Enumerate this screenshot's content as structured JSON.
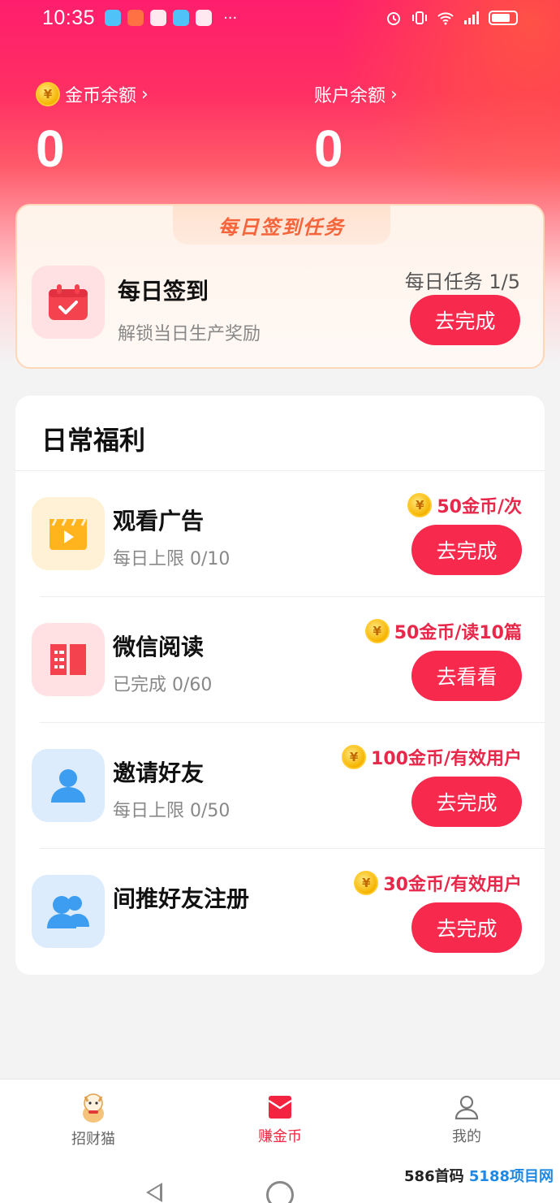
{
  "status_bar": {
    "time": "10:35",
    "more": "···"
  },
  "balances": {
    "coins": {
      "label": "金币余额",
      "value": "0",
      "chevron": "›"
    },
    "account": {
      "label": "账户余额",
      "value": "0",
      "chevron": "›"
    },
    "coin_glyph": "¥"
  },
  "sign_in": {
    "tab_title": "每日签到任务",
    "task_title": "每日签到",
    "task_subtitle": "解锁当日生产奖励",
    "progress": "每日任务 1/5",
    "button": "去完成"
  },
  "welfare": {
    "title": "日常福利",
    "items": [
      {
        "title": "观看广告",
        "subtitle": "每日上限 0/10",
        "reward": "50金币/次",
        "button": "去完成",
        "icon": "video-icon"
      },
      {
        "title": "微信阅读",
        "subtitle": "已完成 0/60",
        "reward": "50金币/读10篇",
        "button": "去看看",
        "icon": "book-icon"
      },
      {
        "title": "邀请好友",
        "subtitle": "每日上限 0/50",
        "reward": "100金币/有效用户",
        "button": "去完成",
        "icon": "user-icon"
      },
      {
        "title": "间推好友注册",
        "subtitle": "",
        "reward": "30金币/有效用户",
        "button": "去完成",
        "icon": "users-icon"
      }
    ]
  },
  "bottom_nav": {
    "items": [
      {
        "label": "招财猫",
        "icon": "lucky-cat-icon"
      },
      {
        "label": "赚金币",
        "icon": "envelope-icon",
        "active": true
      },
      {
        "label": "我的",
        "icon": "profile-icon"
      }
    ]
  },
  "watermark": {
    "text_a": "586首码",
    "text_b": "5188项目网"
  },
  "colors": {
    "accent": "#f72a4e",
    "reward": "#e8284a",
    "hero": "#ff1e6d"
  }
}
